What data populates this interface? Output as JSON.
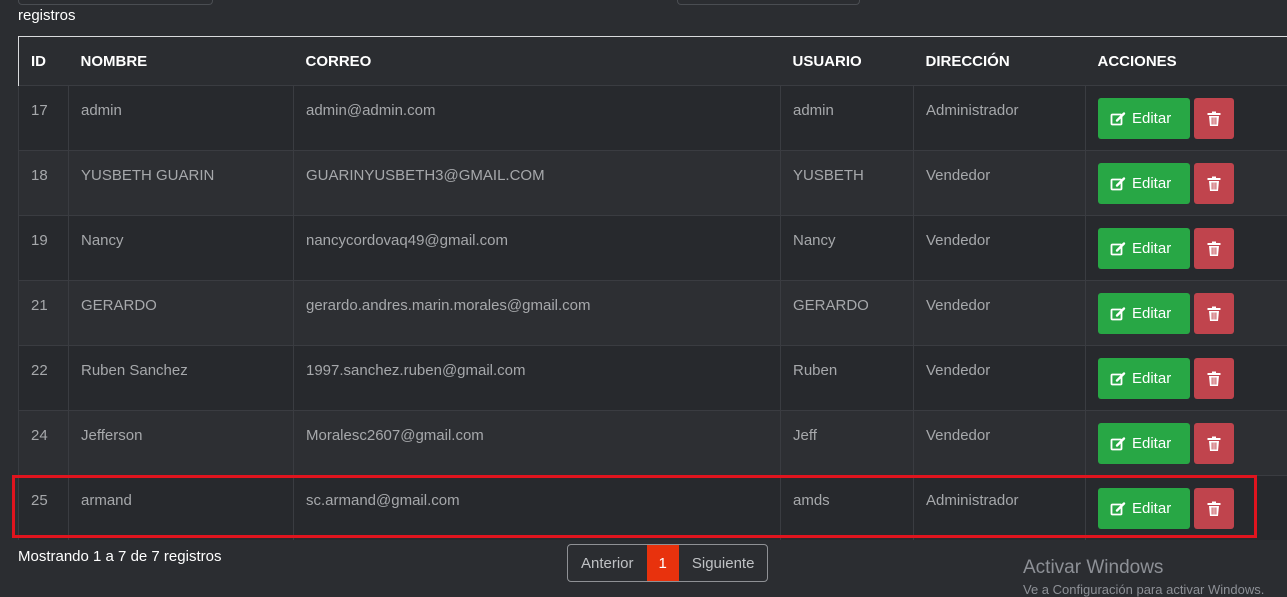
{
  "top": {
    "entries_suffix": "registros"
  },
  "table": {
    "headers": [
      "ID",
      "NOMBRE",
      "CORREO",
      "USUARIO",
      "DIRECCIÓN",
      "ACCIONES"
    ],
    "edit_label": "Editar",
    "rows": [
      {
        "id": "17",
        "nombre": "admin",
        "correo": "admin@admin.com",
        "usuario": "admin",
        "direccion": "Administrador"
      },
      {
        "id": "18",
        "nombre": "YUSBETH GUARIN",
        "correo": "GUARINYUSBETH3@GMAIL.COM",
        "usuario": "YUSBETH",
        "direccion": "Vendedor"
      },
      {
        "id": "19",
        "nombre": "Nancy",
        "correo": "nancycordovaq49@gmail.com",
        "usuario": "Nancy",
        "direccion": "Vendedor"
      },
      {
        "id": "21",
        "nombre": "GERARDO",
        "correo": "gerardo.andres.marin.morales@gmail.com",
        "usuario": "GERARDO",
        "direccion": "Vendedor"
      },
      {
        "id": "22",
        "nombre": "Ruben Sanchez",
        "correo": "1997.sanchez.ruben@gmail.com",
        "usuario": "Ruben",
        "direccion": "Vendedor"
      },
      {
        "id": "24",
        "nombre": "Jefferson",
        "correo": "Moralesc2607@gmail.com",
        "usuario": "Jeff",
        "direccion": "Vendedor"
      },
      {
        "id": "25",
        "nombre": "armand",
        "correo": "sc.armand@gmail.com",
        "usuario": "amds",
        "direccion": "Administrador"
      }
    ]
  },
  "footer": {
    "info": "Mostrando 1 a 7 de 7 registros",
    "prev": "Anterior",
    "page": "1",
    "next": "Siguiente"
  },
  "watermark": {
    "title": "Activar Windows",
    "subtitle": "Ve a Configuración para activar Windows."
  },
  "colors": {
    "edit_button": "#28a745",
    "delete_button": "#c0444d",
    "active_page": "#e8320d",
    "highlight_border": "#e0141e"
  },
  "icons": [
    "edit-icon",
    "trash-icon"
  ]
}
